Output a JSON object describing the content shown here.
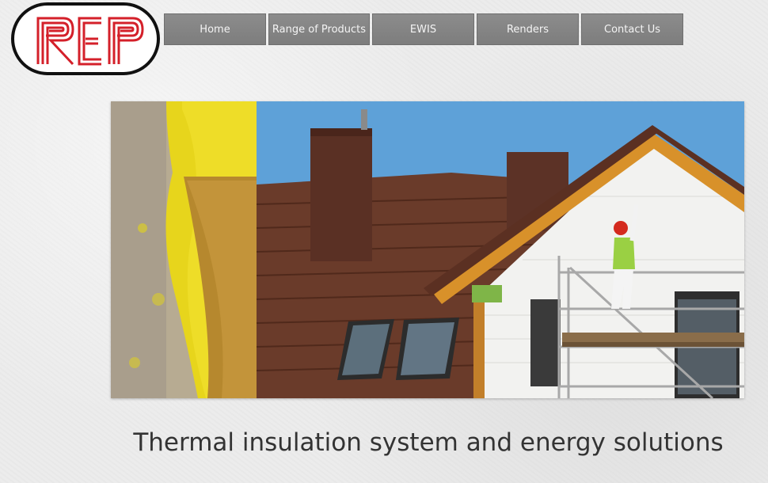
{
  "brand": {
    "logo_text": "REP",
    "colors": {
      "logo_red": "#d4202a",
      "logo_border": "#111111"
    }
  },
  "nav": {
    "items": [
      {
        "label": "Home"
      },
      {
        "label": "Range of Products"
      },
      {
        "label": "EWIS"
      },
      {
        "label": "Renders"
      },
      {
        "label": "Contact Us"
      }
    ],
    "colors": {
      "button_bg": "#858585",
      "button_text": "#f4f4f4"
    }
  },
  "hero": {
    "icon": "hero-image"
  },
  "tagline": "Thermal insulation system and energy solutions"
}
